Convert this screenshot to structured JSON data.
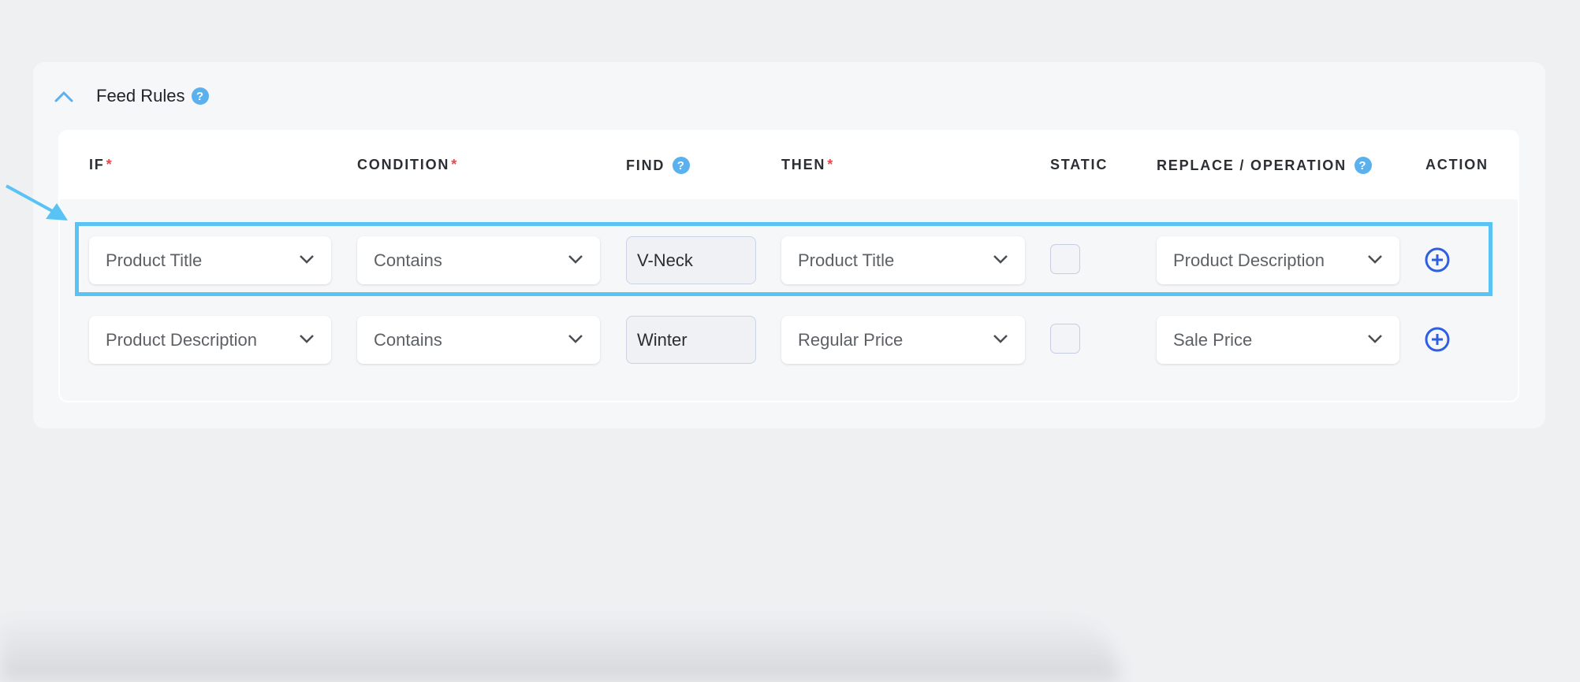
{
  "section": {
    "title": "Feed Rules",
    "help_icon": "?"
  },
  "table": {
    "headers": [
      {
        "label": "IF",
        "required": "*"
      },
      {
        "label": "CONDITION",
        "required": "*"
      },
      {
        "label": "FIND",
        "help": "?"
      },
      {
        "label": "THEN",
        "required": "*"
      },
      {
        "label": "STATIC"
      },
      {
        "label": "REPLACE / OPERATION",
        "help": "?"
      },
      {
        "label": "ACTION"
      }
    ],
    "rows": [
      {
        "if": "Product Title",
        "condition": "Contains",
        "find": "V-Neck",
        "then": "Product Title",
        "static": false,
        "replace": "Product Description",
        "highlighted": true
      },
      {
        "if": "Product Description",
        "condition": "Contains",
        "find": "Winter",
        "then": "Regular Price",
        "static": false,
        "replace": "Sale Price",
        "highlighted": false
      }
    ]
  },
  "colors": {
    "accent": "#5ab1ee",
    "highlight": "#5ac3f5",
    "required": "#e5484d",
    "action_icon": "#2f5fe0"
  }
}
